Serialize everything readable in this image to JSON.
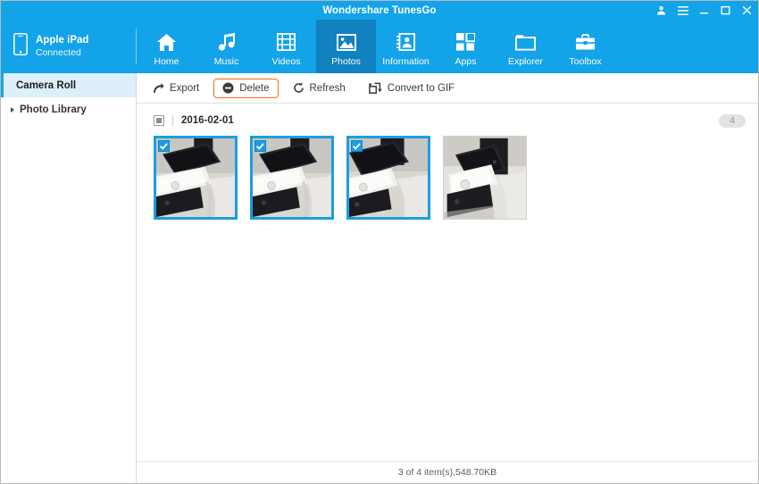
{
  "window": {
    "title": "Wondershare TunesGo",
    "controls": [
      {
        "name": "account-icon",
        "label": "Account"
      },
      {
        "name": "menu-icon",
        "label": "Menu"
      },
      {
        "name": "minimize-button",
        "label": "Minimize"
      },
      {
        "name": "maximize-button",
        "label": "Maximize"
      },
      {
        "name": "close-button",
        "label": "Close"
      }
    ]
  },
  "device": {
    "icon": "tablet-icon",
    "name": "Apple iPad",
    "status": "Connected"
  },
  "nav": {
    "items": [
      {
        "label": "Home",
        "icon": "home-icon",
        "active": false
      },
      {
        "label": "Music",
        "icon": "music-note-icon",
        "active": false
      },
      {
        "label": "Videos",
        "icon": "film-strip-icon",
        "active": false
      },
      {
        "label": "Photos",
        "icon": "photo-icon",
        "active": true
      },
      {
        "label": "Information",
        "icon": "contacts-icon",
        "active": false
      },
      {
        "label": "Apps",
        "icon": "grid-icon",
        "active": false
      },
      {
        "label": "Explorer",
        "icon": "folder-icon",
        "active": false
      },
      {
        "label": "Toolbox",
        "icon": "briefcase-icon",
        "active": false
      }
    ]
  },
  "sidebar": {
    "items": [
      {
        "label": "Camera Roll",
        "active": true,
        "expandable": false
      },
      {
        "label": "Photo Library",
        "active": false,
        "expandable": true
      }
    ]
  },
  "toolbar": {
    "buttons": [
      {
        "label": "Export",
        "icon": "export-arrow-icon",
        "highlighted": false
      },
      {
        "label": "Delete",
        "icon": "minus-circle-icon",
        "highlighted": true
      },
      {
        "label": "Refresh",
        "icon": "refresh-icon",
        "highlighted": false
      },
      {
        "label": "Convert to GIF",
        "icon": "convert-icon",
        "highlighted": false
      }
    ]
  },
  "group": {
    "date": "2016-02-01",
    "count": "4",
    "checkbox_state": "indeterminate"
  },
  "thumbnails": [
    {
      "selected": true,
      "alt": "photo of stacked smartphones"
    },
    {
      "selected": true,
      "alt": "photo of stacked smartphones"
    },
    {
      "selected": true,
      "alt": "photo of stacked smartphones"
    },
    {
      "selected": false,
      "alt": "photo of stacked smartphones"
    }
  ],
  "statusbar": {
    "text": "3 of 4 item(s),548.70KB"
  },
  "colors": {
    "brand_blue": "#13a3e8",
    "active_tab_blue": "#1281bf",
    "selection_blue": "#1b9ee0",
    "sidebar_active_bg": "#ddeffb",
    "highlight_orange": "#f26c21",
    "badge_gray": "#e3e3e3"
  }
}
